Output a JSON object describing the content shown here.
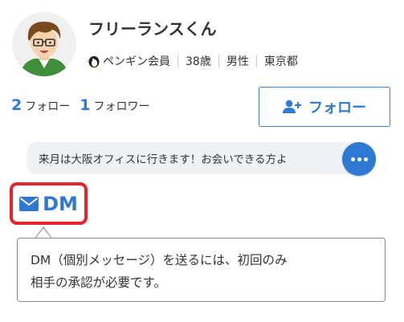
{
  "profile": {
    "name": "フリーランスくん",
    "member_type": "ペンギン会員",
    "age": "38歳",
    "gender": "男性",
    "location": "東京都"
  },
  "stats": {
    "following_count": "2",
    "following_label": "フォロー",
    "followers_count": "1",
    "followers_label": "フォロワー"
  },
  "follow_button": {
    "label": "フォロー"
  },
  "status_message": "来月は大阪オフィスに行きます！お会いできる方よ",
  "dm_button": {
    "label": "DM"
  },
  "tooltip": {
    "line1": "DM（個別メッセージ）を送るには、初回のみ",
    "line2": "相手の承認が必要です。"
  },
  "colors": {
    "accent_blue": "#2f79d3",
    "highlight_red": "#e3242b",
    "bubble_bg": "#eef2f7"
  },
  "icons": [
    "avatar-illustration",
    "penguin-icon",
    "add-user-icon",
    "more-icon",
    "envelope-icon"
  ]
}
